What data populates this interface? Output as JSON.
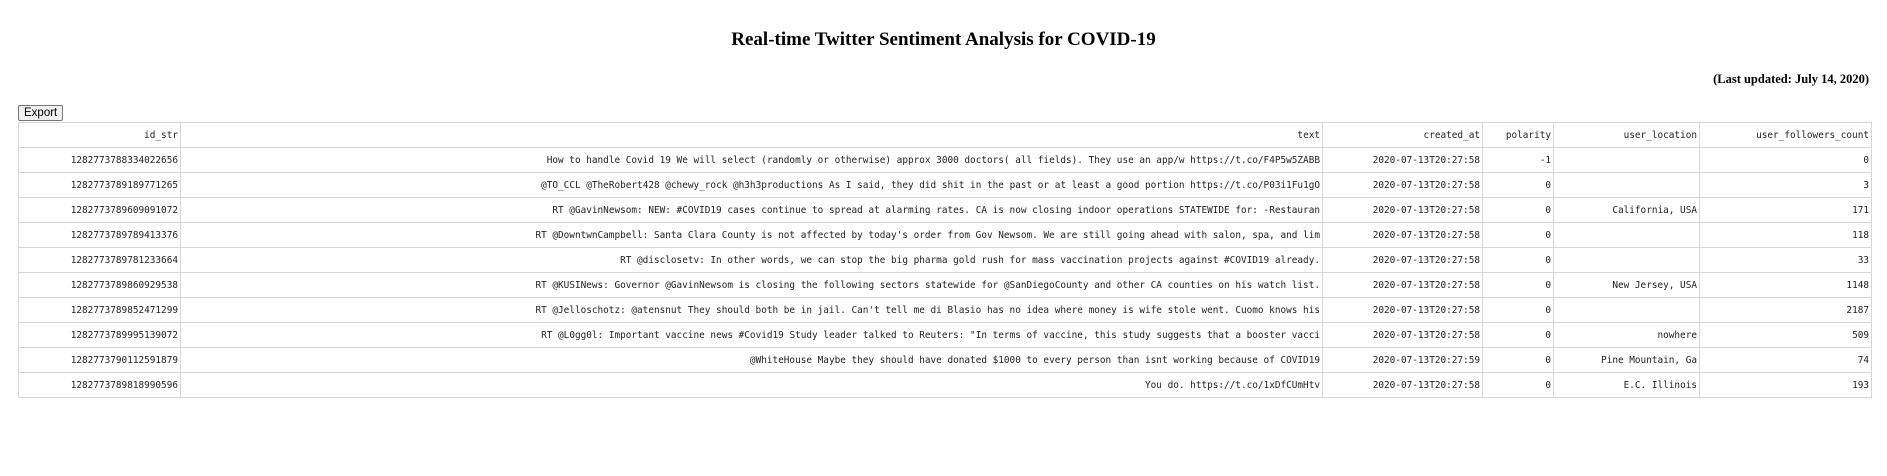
{
  "page": {
    "title": "Real-time Twitter Sentiment Analysis for COVID-19",
    "last_updated": "(Last updated: July 14, 2020)"
  },
  "toolbar": {
    "export_label": "Export"
  },
  "table": {
    "columns": [
      "id_str",
      "text",
      "created_at",
      "polarity",
      "user_location",
      "user_followers_count"
    ],
    "rows": [
      [
        "1282773788334022656",
        "How to handle Covid 19 We will select (randomly or otherwise) approx 3000 doctors( all fields). They use an app/w https://t.co/F4P5w5ZABB",
        "2020-07-13T20:27:58",
        "-1",
        "",
        "0"
      ],
      [
        "1282773789189771265",
        "@TO_CCL @TheRobert428 @chewy_rock @h3h3productions As I said, they did shit in the past or at least a good portion https://t.co/P03i1Fu1gO",
        "2020-07-13T20:27:58",
        "0",
        "",
        "3"
      ],
      [
        "1282773789609091072",
        "RT @GavinNewsom: NEW: #COVID19 cases continue to spread at alarming rates. CA is now closing indoor operations STATEWIDE for: -Restauran",
        "2020-07-13T20:27:58",
        "0",
        "California, USA",
        "171"
      ],
      [
        "1282773789789413376",
        "RT @DowntwnCampbell: Santa Clara County is not affected by today's order from Gov Newsom. We are still going ahead with salon, spa, and lim",
        "2020-07-13T20:27:58",
        "0",
        "",
        "118"
      ],
      [
        "1282773789781233664",
        "RT @disclosetv: In other words, we can stop the big pharma gold rush for mass vaccination projects against #COVID19 already.",
        "2020-07-13T20:27:58",
        "0",
        "",
        "33"
      ],
      [
        "1282773789860929538",
        "RT @KUSINews: Governor @GavinNewsom is closing the following sectors statewide for @SanDiegoCounty and other CA counties on his watch list.",
        "2020-07-13T20:27:58",
        "0",
        "New Jersey, USA",
        "1148"
      ],
      [
        "1282773789852471299",
        "RT @Jelloschotz: @atensnut They should both be in jail. Can't tell me di Blasio has no idea where money is wife stole went. Cuomo knows his",
        "2020-07-13T20:27:58",
        "0",
        "",
        "2187"
      ],
      [
        "1282773789995139072",
        "RT @L0gg0l: Important vaccine news #Covid19 Study leader talked to Reuters: \"In terms of vaccine, this study suggests that a booster vacci",
        "2020-07-13T20:27:58",
        "0",
        "nowhere",
        "509"
      ],
      [
        "1282773790112591879",
        "@WhiteHouse Maybe they should have donated $1000 to every person than isnt working because of COVID19",
        "2020-07-13T20:27:59",
        "0",
        "Pine Mountain, Ga",
        "74"
      ],
      [
        "1282773789818990596",
        "You do. https://t.co/1xDfCUmHtv",
        "2020-07-13T20:27:58",
        "0",
        "E.C. Illinois",
        "193"
      ]
    ]
  }
}
